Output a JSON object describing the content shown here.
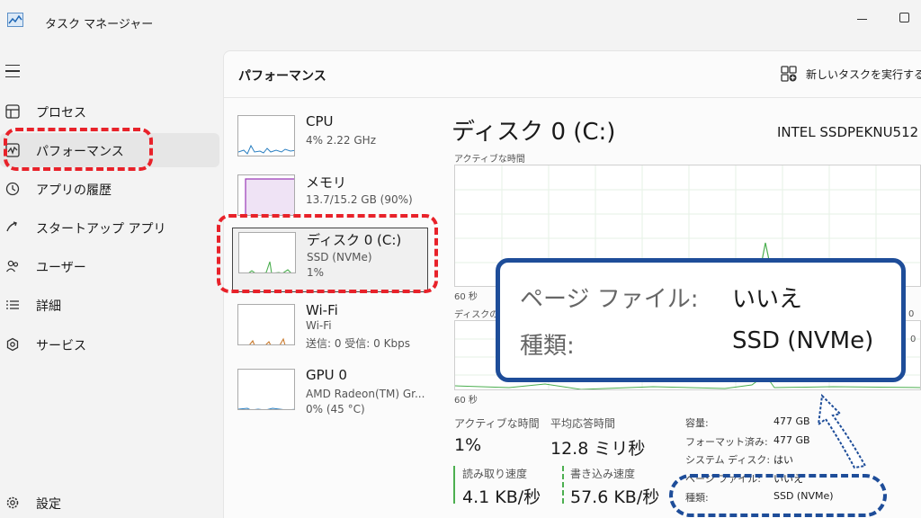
{
  "titlebar": {
    "app_title": "タスク マネージャー"
  },
  "sidebar": {
    "items": [
      {
        "label": "プロセス",
        "icon": "processes-icon"
      },
      {
        "label": "パフォーマンス",
        "icon": "performance-icon"
      },
      {
        "label": "アプリの履歴",
        "icon": "history-icon"
      },
      {
        "label": "スタートアップ アプリ",
        "icon": "startup-icon"
      },
      {
        "label": "ユーザー",
        "icon": "users-icon"
      },
      {
        "label": "詳細",
        "icon": "details-icon"
      },
      {
        "label": "サービス",
        "icon": "services-icon"
      }
    ],
    "settings_label": "設定",
    "active_index": 1
  },
  "header": {
    "title": "パフォーマンス",
    "new_task_label": "新しいタスクを実行する"
  },
  "devices": [
    {
      "name": "CPU",
      "line1": "4% 2.22 GHz",
      "line2": ""
    },
    {
      "name": "メモリ",
      "line1": "13.7/15.2 GB (90%)",
      "line2": ""
    },
    {
      "name": "ディスク 0 (C:)",
      "line1": "SSD (NVMe)",
      "line2": "1%"
    },
    {
      "name": "Wi-Fi",
      "line1": "Wi-Fi",
      "line2": "送信: 0 受信: 0 Kbps"
    },
    {
      "name": "GPU 0",
      "line1": "AMD Radeon(TM) Gr...",
      "line2": "0% (45 °C)"
    }
  ],
  "detail": {
    "title": "ディスク 0 (C:)",
    "model": "INTEL SSDPEKNU512",
    "chart1_caption": "アクティブな時間",
    "chart1_time": "60 秒",
    "chart2_caption": "ディスクの転",
    "chart2_time": "60 秒",
    "right_axis_1": "0",
    "right_axis_2": "0",
    "stats": {
      "active_time_label": "アクティブな時間",
      "active_time_value": "1%",
      "avg_response_label": "平均応答時間",
      "avg_response_value": "12.8 ミリ秒",
      "read_speed_label": "読み取り速度",
      "read_speed_value": "4.1 KB/秒",
      "write_speed_label": "書き込み速度",
      "write_speed_value": "57.6 KB/秒"
    },
    "props": [
      {
        "key": "容量:",
        "value": "477 GB"
      },
      {
        "key": "フォーマット済み:",
        "value": "477 GB"
      },
      {
        "key": "システム ディスク:",
        "value": "はい"
      },
      {
        "key": "ページ ファイル:",
        "value": "いいえ"
      },
      {
        "key": "種類:",
        "value": "SSD (NVMe)"
      }
    ]
  },
  "callout": {
    "row1_key": "ページ ファイル:",
    "row1_value": "いいえ",
    "row2_key": "種類:",
    "row2_value": "SSD (NVMe)"
  },
  "colors": {
    "annotation_red": "#e8222a",
    "annotation_blue": "#1e4d99",
    "cpu_line": "#2a7fc1",
    "memory_line": "#9a3ab8",
    "disk_line": "#4caf50",
    "wifi_line": "#c9792b"
  }
}
